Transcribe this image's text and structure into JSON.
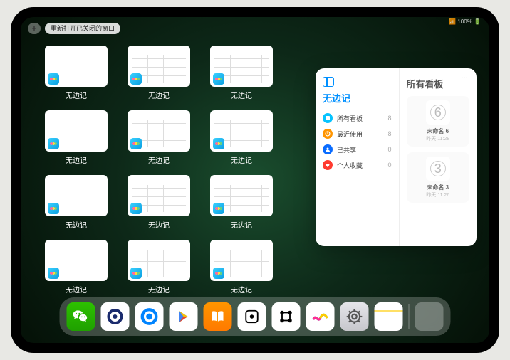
{
  "status": "📶 100% 🔋",
  "topbar": {
    "plus": "+",
    "reopen": "重新打开已关闭的窗口"
  },
  "app_name": "无边记",
  "windows": [
    {
      "type": "blank"
    },
    {
      "type": "cal"
    },
    {
      "type": "cal"
    },
    {
      "type": "blank"
    },
    {
      "type": "cal"
    },
    {
      "type": "cal"
    },
    {
      "type": "blank"
    },
    {
      "type": "cal"
    },
    {
      "type": "cal"
    },
    {
      "type": "blank"
    },
    {
      "type": "cal"
    },
    {
      "type": "cal"
    }
  ],
  "panel": {
    "handle": "…",
    "left": {
      "title": "无边记",
      "rows": [
        {
          "icon": "grid",
          "color": "#06c3ff",
          "label": "所有看板",
          "count": "8"
        },
        {
          "icon": "clock",
          "color": "#ff9500",
          "label": "最近使用",
          "count": "8"
        },
        {
          "icon": "people",
          "color": "#0a6cff",
          "label": "已共享",
          "count": "0"
        },
        {
          "icon": "heart",
          "color": "#ff3b30",
          "label": "个人收藏",
          "count": "0"
        }
      ]
    },
    "right": {
      "title": "所有看板",
      "cards": [
        {
          "digit": "6",
          "title": "未命名 6",
          "sub": "昨天 11:28"
        },
        {
          "digit": "3",
          "title": "未命名 3",
          "sub": "昨天 11:26"
        }
      ]
    }
  },
  "dock": [
    {
      "name": "wechat",
      "bg": "linear-gradient(#2dc100,#1fa000)",
      "glyph": "wechat"
    },
    {
      "name": "quark",
      "bg": "#fff",
      "glyph": "quark"
    },
    {
      "name": "qqbrowser",
      "bg": "#fff",
      "glyph": "qb"
    },
    {
      "name": "play",
      "bg": "#fff",
      "glyph": "play"
    },
    {
      "name": "books",
      "bg": "linear-gradient(#ff9500,#ff7a00)",
      "glyph": "books"
    },
    {
      "name": "dice",
      "bg": "#fff",
      "glyph": "dice"
    },
    {
      "name": "connect",
      "bg": "#fff",
      "glyph": "connect"
    },
    {
      "name": "freeform",
      "bg": "#fff",
      "glyph": "freeform"
    },
    {
      "name": "settings",
      "bg": "linear-gradient(#e5e5ea,#c7c7cc)",
      "glyph": "gear"
    },
    {
      "name": "notes",
      "bg": "linear-gradient(#fff 0 28%,#ffe066 28% 34%,#fff 34%)",
      "glyph": ""
    }
  ]
}
